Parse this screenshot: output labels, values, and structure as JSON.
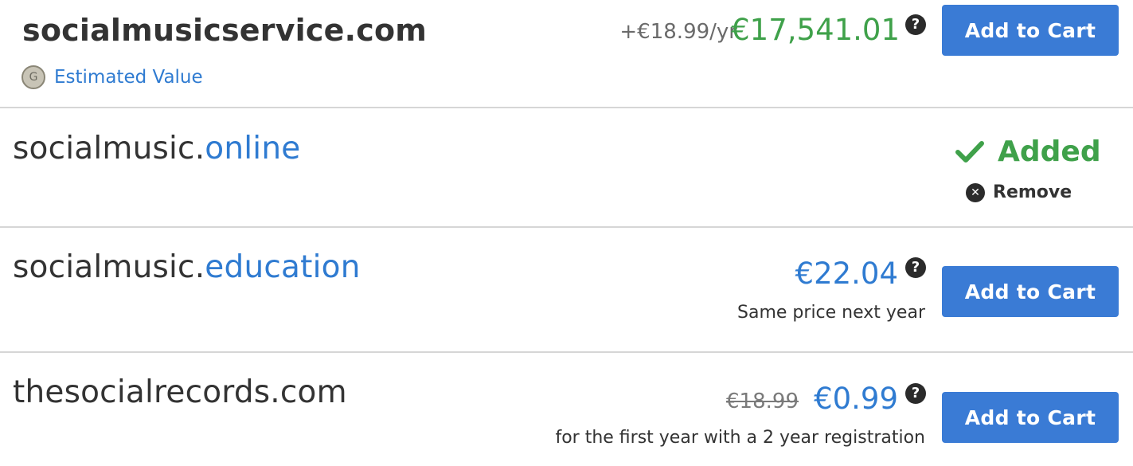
{
  "results": [
    {
      "domain": "socialmusicservice.com",
      "renewal": "+€18.99/yr",
      "price": "€17,541.01",
      "help": "?",
      "estimated_icon": "G",
      "estimated_label": "Estimated Value",
      "button": "Add to Cart"
    },
    {
      "domain_base": "socialmusic.",
      "domain_tld": "online",
      "status": "Added",
      "remove_icon": "✕",
      "remove_label": "Remove"
    },
    {
      "domain_base": "socialmusic.",
      "domain_tld": "education",
      "price": "€22.04",
      "help": "?",
      "note": "Same price next year",
      "button": "Add to Cart"
    },
    {
      "domain": "thesocialrecords.com",
      "old_price": "€18.99",
      "price": "€0.99",
      "help": "?",
      "note": "for the first year with a 2 year registration",
      "button": "Add to Cart"
    }
  ],
  "colors": {
    "accent_blue": "#3a7bd5",
    "price_green": "#3fa14a",
    "link_blue": "#2f7bd1"
  }
}
